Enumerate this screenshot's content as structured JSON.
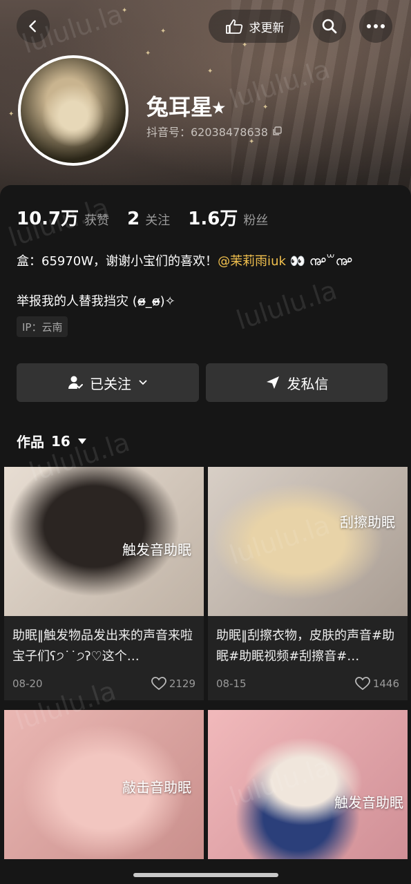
{
  "header": {
    "update_label": "求更新"
  },
  "profile": {
    "nickname": "兔耳星⭑",
    "douyin_id": "抖音号：62038478638"
  },
  "stats": [
    {
      "num": "10.7万",
      "label": "获赞"
    },
    {
      "num": "2",
      "label": "关注"
    },
    {
      "num": "1.6万",
      "label": "粉丝"
    }
  ],
  "bio": {
    "line1_text": "盒：65970W，谢谢小宝们的喜欢！",
    "line1_mention": "@茉莉雨iuk",
    "line1_emoji": "👀  ൲꒳൲",
    "line2": "举报我的人替我挡灾 (ɞ̴̶̷_ɞ̴̶̷)✧",
    "ip": "IP：云南"
  },
  "actions": {
    "follow_label": "已关注",
    "message_label": "发私信"
  },
  "works": {
    "label": "作品",
    "count": "16"
  },
  "videos": [
    {
      "overlay": "触发音助眠",
      "title": "助眠‖触发物品发出来的声音来啦宝子们ʕ੭˙˙੭ʔ♡这个…",
      "date": "08-20",
      "likes": "2129"
    },
    {
      "overlay": "刮擦助眠",
      "title": "助眠‖刮擦衣物，皮肤的声音#助眠#助眠视频#刮擦音#…",
      "date": "08-15",
      "likes": "1446"
    },
    {
      "overlay": "敲击音助眠",
      "title": "",
      "date": "",
      "likes": ""
    },
    {
      "overlay": "触发音助眠",
      "title": "",
      "date": "",
      "likes": ""
    }
  ],
  "watermark": "lululu.la",
  "colors": {
    "mention": "#f2c14e",
    "background": "#161616",
    "button": "#333333"
  }
}
